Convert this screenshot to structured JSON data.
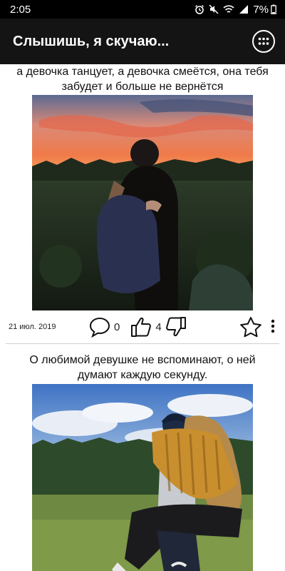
{
  "status_bar": {
    "time": "2:05",
    "battery": "7%",
    "icons": [
      "alarm-icon",
      "mute-icon",
      "wifi-icon",
      "signal-icon",
      "battery-icon"
    ]
  },
  "app_bar": {
    "title": "Слышишь, я скучаю...",
    "menu_icon": "grid-menu-icon"
  },
  "posts": [
    {
      "caption": "а девочка танцует, а девочка смеётся, она тебя забудет и больше не вернётся",
      "image": "sunset-couple-hug-photo",
      "date": "21 июл. 2019",
      "comments": "0",
      "likes": "4"
    },
    {
      "caption": "О любимой девушке не вспоминают, о ней думают каждую секунду.",
      "image": "couple-piggyback-photo"
    }
  ],
  "colors": {
    "status_bar_bg": "#000000",
    "app_bar_bg": "#141414",
    "text": "#111111"
  }
}
